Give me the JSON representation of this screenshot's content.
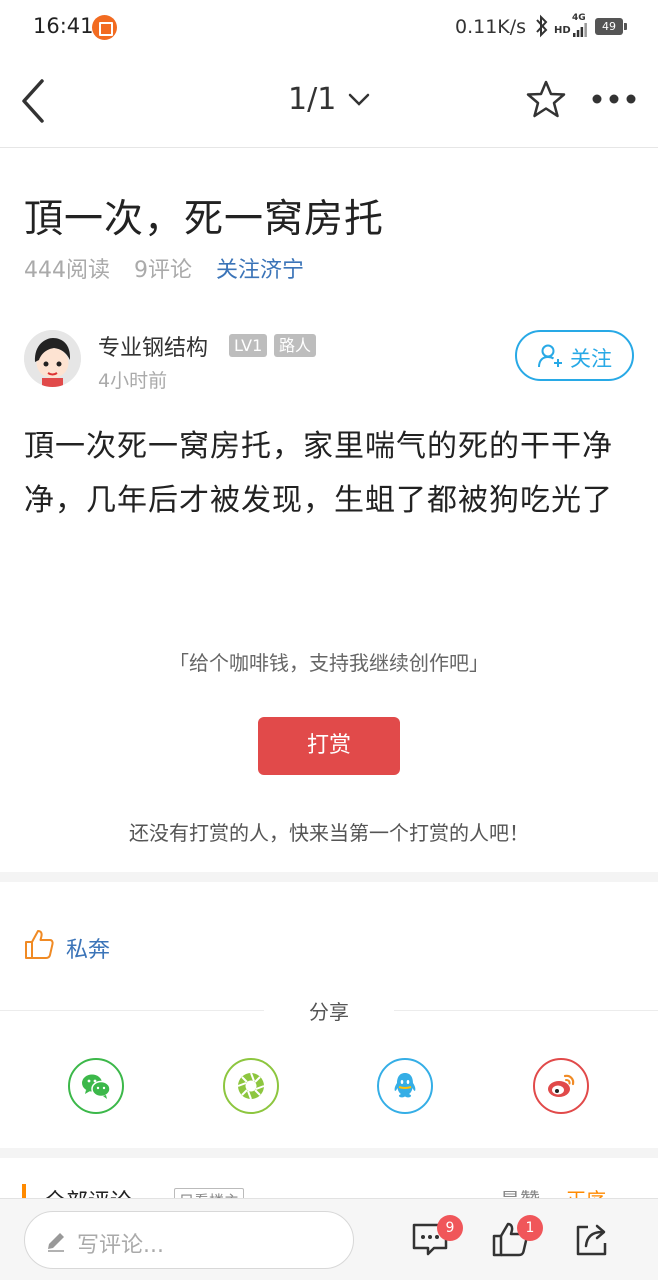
{
  "status_bar": {
    "time": "16:41",
    "network_speed": "0.11K/s",
    "hd_label": "HD",
    "network_type": "4G",
    "battery": "49",
    "icons": [
      "app-notification-icon",
      "bluetooth-icon",
      "signal-icon",
      "battery-icon"
    ]
  },
  "nav": {
    "page_indicator": "1/1",
    "icons": [
      "back-icon",
      "chevron-down-icon",
      "star-icon",
      "more-icon"
    ]
  },
  "article": {
    "title": "頂一次，死一窝房托",
    "reads": "444阅读",
    "comments": "9评论",
    "follow_city": "关注济宁",
    "body": "頂一次死一窝房托，家里喘气的死的干干净净，几年后才被发现，生蛆了都被狗吃光了"
  },
  "author": {
    "name": "专业钢结构",
    "level": "LV1",
    "role": "路人",
    "time": "4小时前",
    "follow_label": "关注"
  },
  "reward": {
    "slogan": "「给个咖啡钱，支持我继续创作吧」",
    "button_label": "打赏",
    "tip": "还没有打赏的人，快来当第一个打赏的人吧！"
  },
  "like": {
    "label": "私奔"
  },
  "share": {
    "title": "分享",
    "targets": [
      "wechat-icon",
      "moments-icon",
      "qq-icon",
      "weibo-icon"
    ]
  },
  "comments_header": {
    "title": "全部评论",
    "only_author": "只看楼主",
    "sort_hot": "最赞",
    "sort_order": "正序"
  },
  "bottom_bar": {
    "input_placeholder": "写评论...",
    "comment_count": "9",
    "like_count": "1"
  },
  "colors": {
    "accent_blue": "#28a9e6",
    "link_blue": "#3b74b8",
    "reward_red": "#e14a4a",
    "orange": "#ff8a00"
  }
}
